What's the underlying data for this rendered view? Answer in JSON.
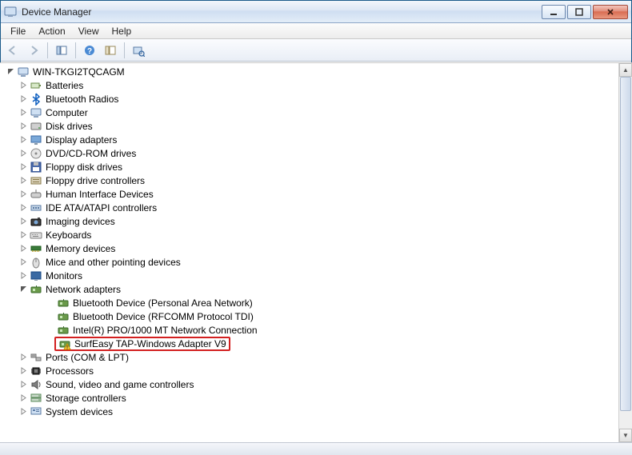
{
  "window": {
    "title": "Device Manager"
  },
  "menu": {
    "file": "File",
    "action": "Action",
    "view": "View",
    "help": "Help"
  },
  "toolbar": {
    "back_tip": "Back",
    "forward_tip": "Forward",
    "show_hide_tip": "Show/Hide Console Tree",
    "help_tip": "Help",
    "properties_tip": "Properties",
    "scan_tip": "Scan for hardware changes"
  },
  "tree": {
    "root": {
      "label": "WIN-TKGI2TQCAGM",
      "expanded": true,
      "icon": "computer-icon"
    },
    "categories": [
      {
        "label": "Batteries",
        "icon": "battery-icon",
        "expanded": false
      },
      {
        "label": "Bluetooth Radios",
        "icon": "bluetooth-icon",
        "expanded": false
      },
      {
        "label": "Computer",
        "icon": "computer-icon",
        "expanded": false
      },
      {
        "label": "Disk drives",
        "icon": "disk-icon",
        "expanded": false
      },
      {
        "label": "Display adapters",
        "icon": "display-icon",
        "expanded": false
      },
      {
        "label": "DVD/CD-ROM drives",
        "icon": "cdrom-icon",
        "expanded": false
      },
      {
        "label": "Floppy disk drives",
        "icon": "floppy-icon",
        "expanded": false
      },
      {
        "label": "Floppy drive controllers",
        "icon": "floppy-ctrl-icon",
        "expanded": false
      },
      {
        "label": "Human Interface Devices",
        "icon": "hid-icon",
        "expanded": false
      },
      {
        "label": "IDE ATA/ATAPI controllers",
        "icon": "ide-icon",
        "expanded": false
      },
      {
        "label": "Imaging devices",
        "icon": "imaging-icon",
        "expanded": false
      },
      {
        "label": "Keyboards",
        "icon": "keyboard-icon",
        "expanded": false
      },
      {
        "label": "Memory devices",
        "icon": "memory-icon",
        "expanded": false
      },
      {
        "label": "Mice and other pointing devices",
        "icon": "mouse-icon",
        "expanded": false
      },
      {
        "label": "Monitors",
        "icon": "monitor-icon",
        "expanded": false
      },
      {
        "label": "Network adapters",
        "icon": "network-icon",
        "expanded": true,
        "children": [
          {
            "label": "Bluetooth Device (Personal Area Network)",
            "icon": "network-icon"
          },
          {
            "label": "Bluetooth Device (RFCOMM Protocol TDI)",
            "icon": "network-icon"
          },
          {
            "label": "Intel(R) PRO/1000 MT Network Connection",
            "icon": "network-icon"
          },
          {
            "label": "SurfEasy TAP-Windows Adapter V9",
            "icon": "network-warn-icon",
            "highlighted": true
          }
        ]
      },
      {
        "label": "Ports (COM & LPT)",
        "icon": "ports-icon",
        "expanded": false
      },
      {
        "label": "Processors",
        "icon": "cpu-icon",
        "expanded": false
      },
      {
        "label": "Sound, video and game controllers",
        "icon": "sound-icon",
        "expanded": false
      },
      {
        "label": "Storage controllers",
        "icon": "storage-icon",
        "expanded": false
      },
      {
        "label": "System devices",
        "icon": "system-icon",
        "expanded": false
      }
    ]
  }
}
